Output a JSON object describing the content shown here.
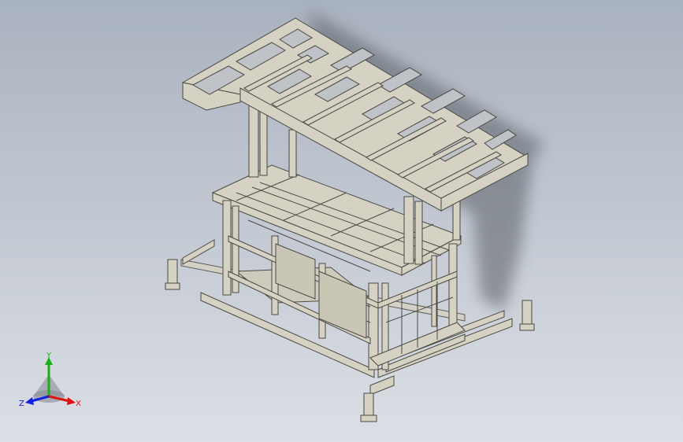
{
  "viewport": {
    "background_top": "#a9b2bf",
    "background_bottom": "#dcdfe5",
    "model_fill": "#d6d2c3",
    "model_edge": "#4a4a44"
  },
  "triad": {
    "x_label": "X",
    "y_label": "Y",
    "z_label": "Z",
    "x_color": "#e01010",
    "y_color": "#18b018",
    "z_color": "#1020e0"
  }
}
